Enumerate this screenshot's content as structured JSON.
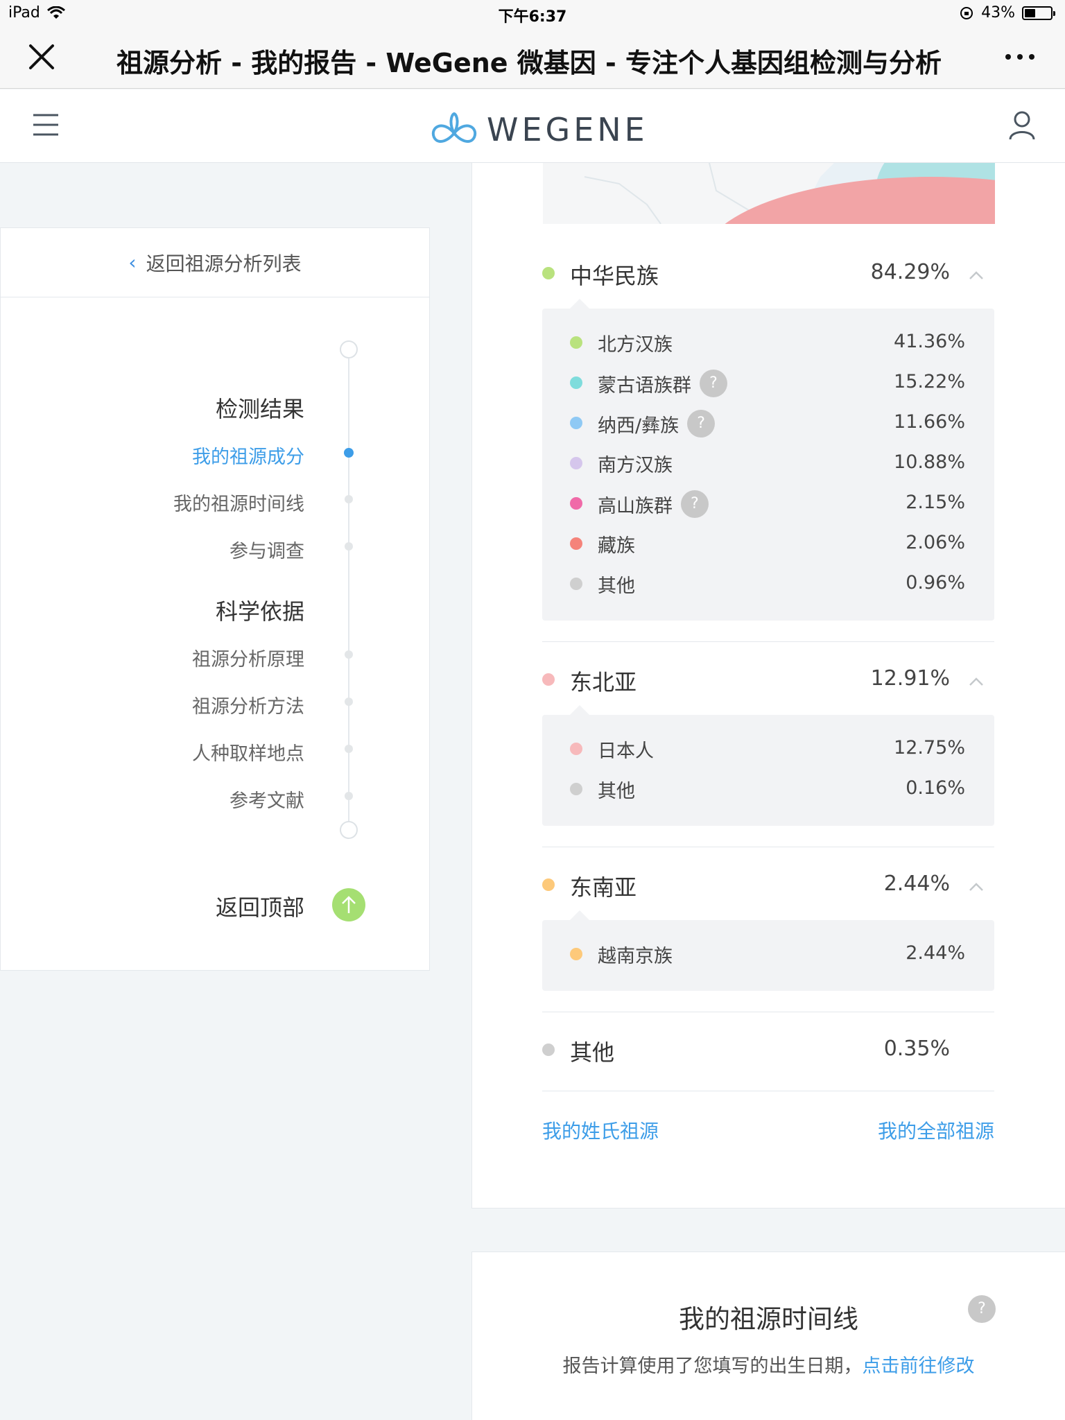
{
  "status": {
    "device": "iPad",
    "time": "下午6:37",
    "battery": "43%",
    "battery_level": 0.43
  },
  "browser": {
    "title": "祖源分析 - 我的报告 - WeGene 微基因 - 专注个人基因组检测与分析"
  },
  "site": {
    "logo_text": "WEGENE"
  },
  "sidebar": {
    "back_label": "返回祖源分析列表",
    "sections": [
      {
        "heading": "检测结果",
        "items": [
          "我的祖源成分",
          "我的祖源时间线",
          "参与调查"
        ]
      },
      {
        "heading": "科学依据",
        "items": [
          "祖源分析原理",
          "祖源分析方法",
          "人种取样地点",
          "参考文献"
        ]
      }
    ],
    "back_to_top": "返回顶部"
  },
  "ancestry": {
    "groups": [
      {
        "name": "中华民族",
        "value": "84.29%",
        "color": "#b9e27e",
        "items": [
          {
            "name": "北方汉族",
            "value": "41.36%",
            "color": "#b9e27e",
            "help": false
          },
          {
            "name": "蒙古语族群",
            "value": "15.22%",
            "color": "#7fdcdc",
            "help": true
          },
          {
            "name": "纳西/彝族",
            "value": "11.66%",
            "color": "#8fc9f4",
            "help": true
          },
          {
            "name": "南方汉族",
            "value": "10.88%",
            "color": "#d5c6ec",
            "help": false
          },
          {
            "name": "高山族群",
            "value": "2.15%",
            "color": "#f06aa8",
            "help": true
          },
          {
            "name": "藏族",
            "value": "2.06%",
            "color": "#f5837a",
            "help": false
          },
          {
            "name": "其他",
            "value": "0.96%",
            "color": "#cfcfcf",
            "help": false
          }
        ]
      },
      {
        "name": "东北亚",
        "value": "12.91%",
        "color": "#f7b9bb",
        "items": [
          {
            "name": "日本人",
            "value": "12.75%",
            "color": "#f7b9bb",
            "help": false
          },
          {
            "name": "其他",
            "value": "0.16%",
            "color": "#cfcfcf",
            "help": false
          }
        ]
      },
      {
        "name": "东南亚",
        "value": "2.44%",
        "color": "#fdc97a",
        "items": [
          {
            "name": "越南京族",
            "value": "2.44%",
            "color": "#fdc97a",
            "help": false
          }
        ]
      },
      {
        "name": "其他",
        "value": "0.35%",
        "color": "#cfcfcf",
        "items": []
      }
    ],
    "help_mark": "?",
    "link_surname": "我的姓氏祖源",
    "link_all": "我的全部祖源"
  },
  "timeline_card": {
    "title": "我的祖源时间线",
    "help_mark": "?",
    "desc": "报告计算使用了您填写的出生日期，",
    "link": "点击前往修改"
  }
}
